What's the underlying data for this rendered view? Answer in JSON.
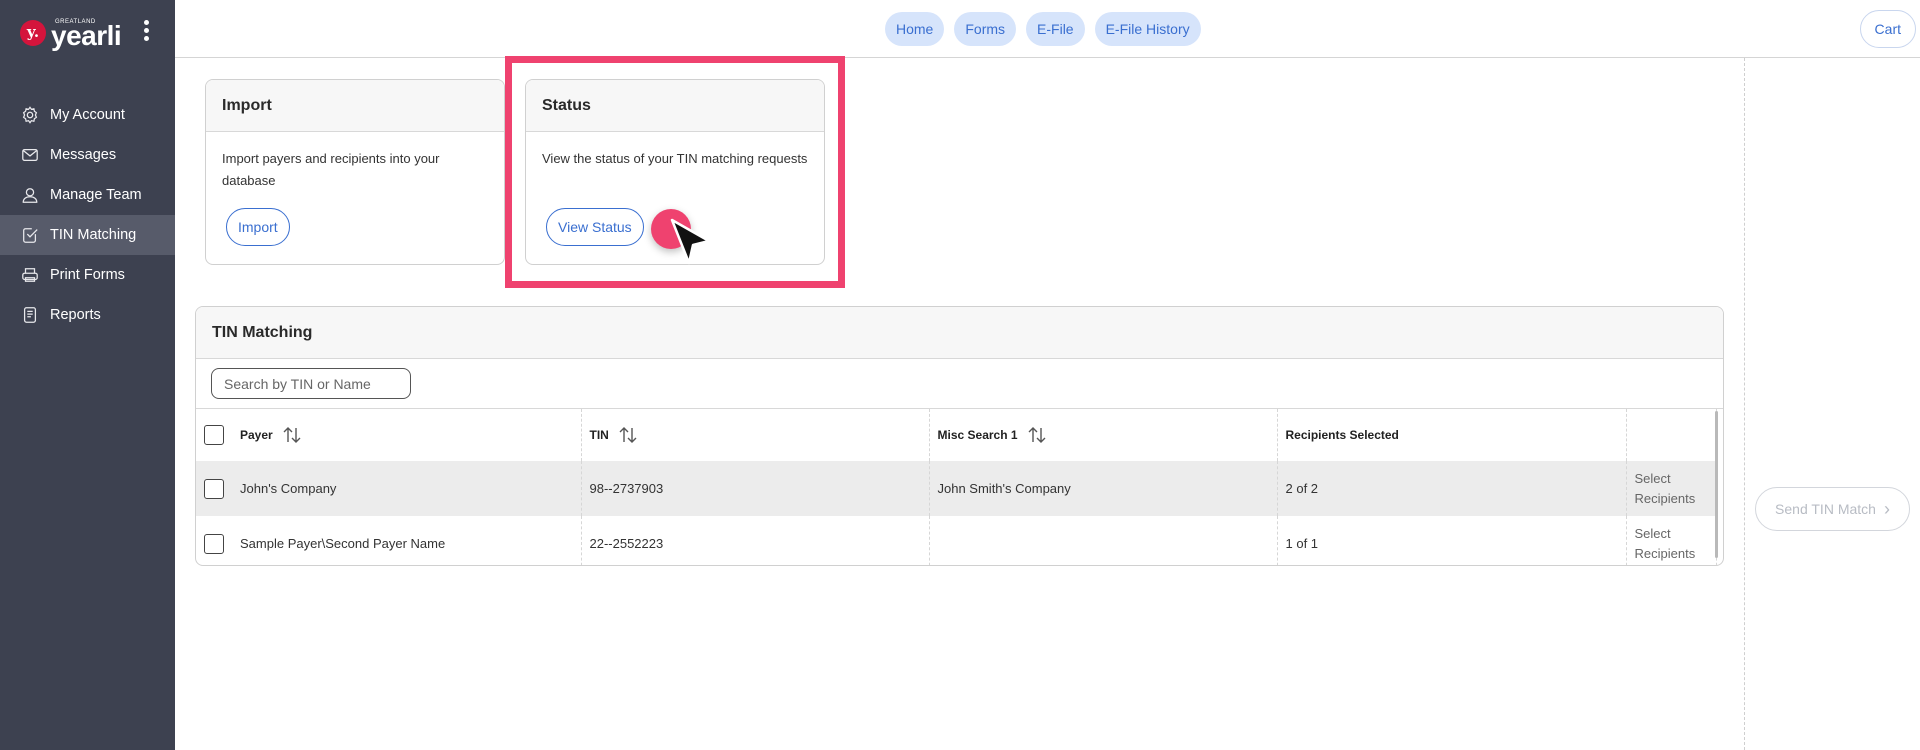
{
  "brand": {
    "small": "GREATLAND",
    "name": "yearli",
    "mark": "y."
  },
  "sidebar": {
    "items": [
      {
        "label": "My Account",
        "icon": "gear-icon"
      },
      {
        "label": "Messages",
        "icon": "mail-icon"
      },
      {
        "label": "Manage Team",
        "icon": "user-icon"
      },
      {
        "label": "TIN Matching",
        "icon": "check-doc-icon",
        "active": true
      },
      {
        "label": "Print Forms",
        "icon": "printer-icon"
      },
      {
        "label": "Reports",
        "icon": "report-icon"
      }
    ]
  },
  "topnav": {
    "home": "Home",
    "forms": "Forms",
    "efile": "E-File",
    "efile_history": "E-File History",
    "cart": "Cart"
  },
  "import_card": {
    "title": "Import",
    "text": "Import payers and recipients into your database",
    "button": "Import"
  },
  "status_card": {
    "title": "Status",
    "text": "View the status of your TIN matching requests",
    "button": "View Status"
  },
  "tin": {
    "title": "TIN Matching",
    "search_placeholder": "Search by TIN or Name",
    "columns": {
      "payer": "Payer",
      "tin": "TIN",
      "misc": "Misc Search 1",
      "recipients": "Recipients Selected"
    },
    "rows": [
      {
        "payer": "John's Company",
        "tin": "98--2737903",
        "misc": "John Smith's Company",
        "recipients": "2 of 2",
        "action1": "Select",
        "action2": "Recipients"
      },
      {
        "payer": "Sample Payer\\Second Payer Name",
        "tin": "22--2552223",
        "misc": "",
        "recipients": "1 of 1",
        "action1": "Select",
        "action2": "Recipients"
      }
    ]
  },
  "send_button": "Send TIN Match",
  "colors": {
    "sidebar": "#3d4150",
    "accent": "#3a6fd0",
    "highlight": "#ef426f",
    "brand_red": "#d4143c"
  }
}
